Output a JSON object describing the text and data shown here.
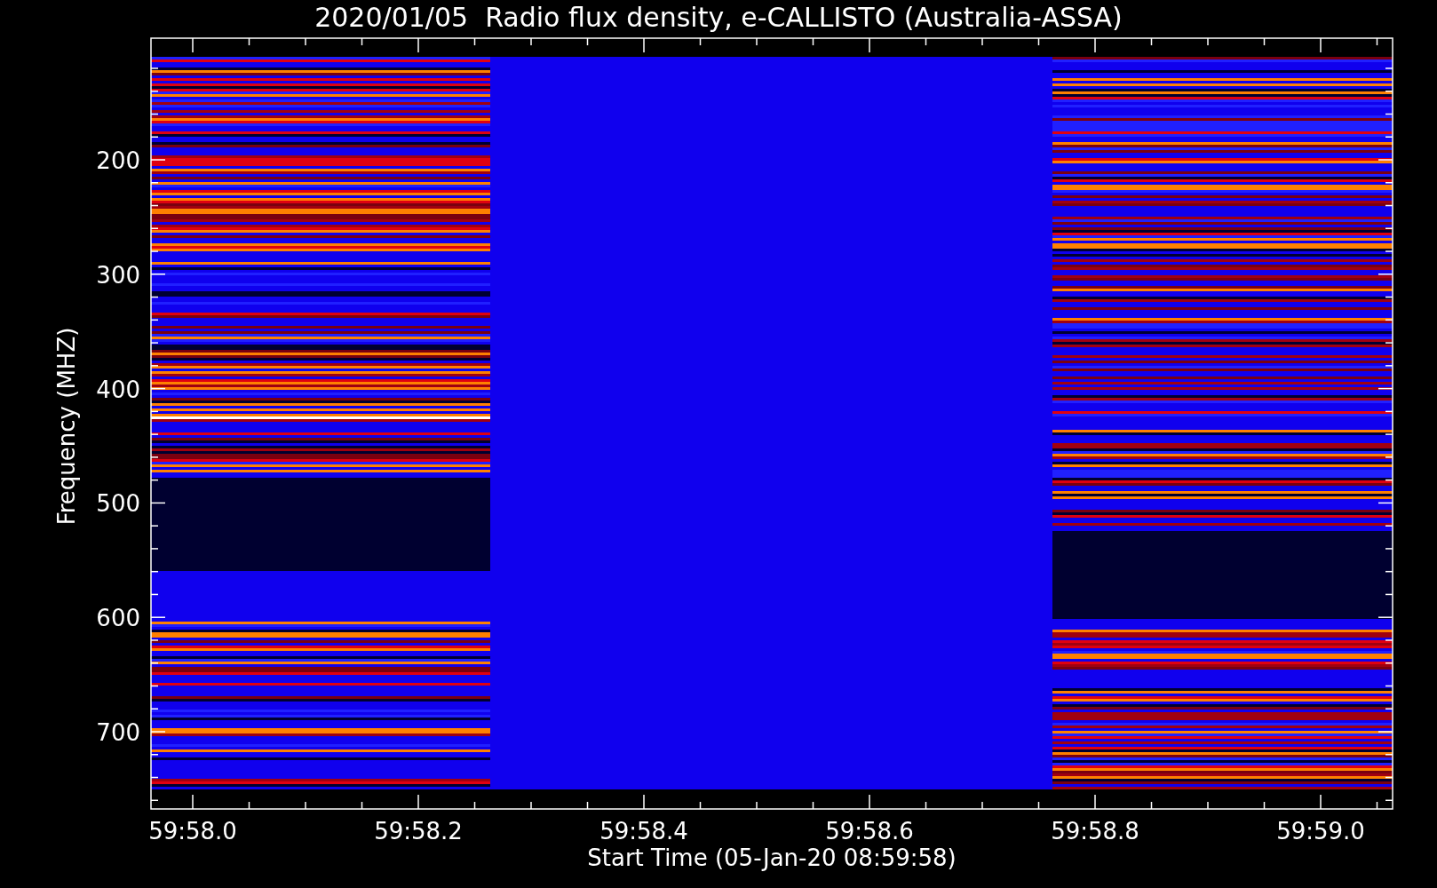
{
  "title": "2020/01/05  Radio flux density, e-CALLISTO (Australia-ASSA)",
  "y_axis": {
    "label": "Frequency (MHZ)",
    "ticks": [
      "200",
      "300",
      "400",
      "500",
      "600",
      "700"
    ]
  },
  "x_axis": {
    "label": "Start Time (05-Jan-20 08:59:58)",
    "ticks": [
      "59:58.0",
      "59:58.2",
      "59:58.4",
      "59:58.6",
      "59:58.8",
      "59:59.0"
    ]
  }
}
